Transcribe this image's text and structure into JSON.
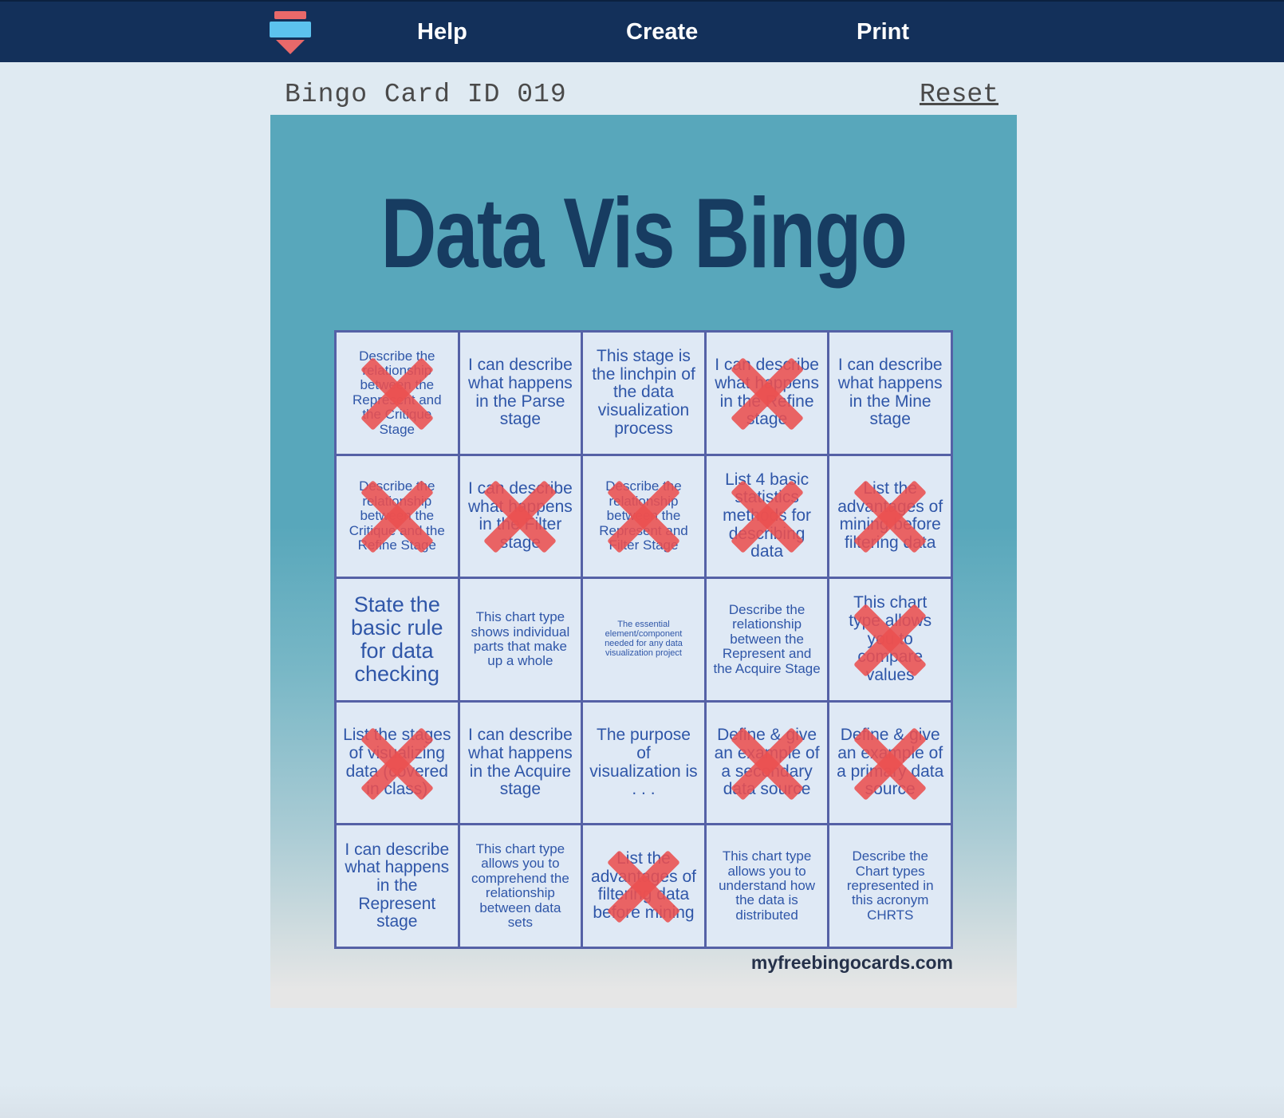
{
  "nav": {
    "logo_icon": "bingo-logo-icon",
    "help_label": "Help",
    "create_label": "Create",
    "print_label": "Print"
  },
  "card_header": {
    "card_id": "Bingo Card ID 019",
    "reset_label": "Reset"
  },
  "card": {
    "title": "Data Vis Bingo",
    "site_credit": "myfreebingocards.com",
    "mark_color": "#eb5050",
    "cells": [
      {
        "text": "Describe the relationship between the Represent and the Critique Stage",
        "marked": true,
        "size": 17
      },
      {
        "text": "I can describe what happens in the Parse stage",
        "marked": false,
        "size": 21
      },
      {
        "text": "This stage is the linchpin of the data visualization process",
        "marked": false,
        "size": 21
      },
      {
        "text": "I can describe what happens in the Refine stage",
        "marked": true,
        "size": 21
      },
      {
        "text": "I can describe what happens in the Mine stage",
        "marked": false,
        "size": 21
      },
      {
        "text": "Describe the relationship between the Critique and the Refine Stage",
        "marked": true,
        "size": 17
      },
      {
        "text": "I can describe what happens in the Filter stage",
        "marked": true,
        "size": 21
      },
      {
        "text": "Describe the relationship between the Represent and Filter Stage",
        "marked": true,
        "size": 17
      },
      {
        "text": "List 4 basic statistics methods for describing data",
        "marked": true,
        "size": 21
      },
      {
        "text": "List the advantages of mining before filtering data",
        "marked": true,
        "size": 21
      },
      {
        "text": "State the basic rule for data checking",
        "marked": false,
        "size": 27
      },
      {
        "text": "This chart type shows individual parts that make up a whole",
        "marked": false,
        "size": 17
      },
      {
        "text": "The essential element/component needed for any data visualization project",
        "marked": false,
        "size": 11
      },
      {
        "text": "Describe the relationship between the Represent and the Acquire Stage",
        "marked": false,
        "size": 17
      },
      {
        "text": "This chart type allows you to compare values",
        "marked": true,
        "size": 21
      },
      {
        "text": "List the stages of visualizing data (covered in class)",
        "marked": true,
        "size": 21
      },
      {
        "text": "I can describe what happens in the Acquire stage",
        "marked": false,
        "size": 21
      },
      {
        "text": "The purpose of visualization is . . .",
        "marked": false,
        "size": 21
      },
      {
        "text": "Define & give an example of a secondary data source",
        "marked": true,
        "size": 21
      },
      {
        "text": "Define & give an example of a primary data source",
        "marked": true,
        "size": 21
      },
      {
        "text": "I can describe what happens in the Represent stage",
        "marked": false,
        "size": 21
      },
      {
        "text": "This chart type allows you to comprehend the relationship between data sets",
        "marked": false,
        "size": 17
      },
      {
        "text": "List the advantages of filtering data before mining",
        "marked": true,
        "size": 21
      },
      {
        "text": "This chart type allows you to understand how the data is distributed",
        "marked": false,
        "size": 17
      },
      {
        "text": "Describe the Chart types represented in this acronym CHRTS",
        "marked": false,
        "size": 17
      }
    ]
  }
}
